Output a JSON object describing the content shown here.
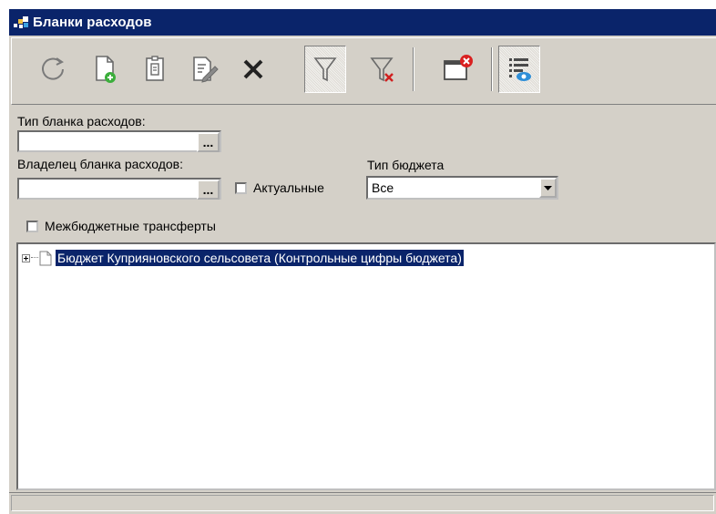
{
  "window": {
    "title": "Бланки расходов",
    "accent": "#0a246a"
  },
  "toolbar": {
    "buttons": [
      {
        "name": "refresh-icon"
      },
      {
        "name": "new-document-icon"
      },
      {
        "name": "copy-document-icon"
      },
      {
        "name": "edit-document-icon"
      },
      {
        "name": "delete-icon"
      },
      {
        "name": "filter-icon",
        "pressed": true
      },
      {
        "name": "clear-filter-icon"
      },
      {
        "name": "close-window-icon"
      },
      {
        "name": "view-list-icon",
        "pressed": true
      }
    ]
  },
  "filters": {
    "expense_form_type": {
      "label": "Тип бланка расходов:",
      "value": "",
      "button": "..."
    },
    "expense_form_owner": {
      "label": "Владелец бланка расходов:",
      "value": "",
      "button": "..."
    },
    "actual": {
      "label": "Актуальные",
      "checked": false
    },
    "budget_type": {
      "label": "Тип бюджета",
      "value": "Все"
    },
    "interbudget": {
      "label": "Межбюджетные трансферты",
      "checked": false
    }
  },
  "tree": {
    "items": [
      {
        "label": "Бюджет Куприяновского сельсовета (Контрольные цифры бюджета)",
        "selected": true
      }
    ]
  }
}
